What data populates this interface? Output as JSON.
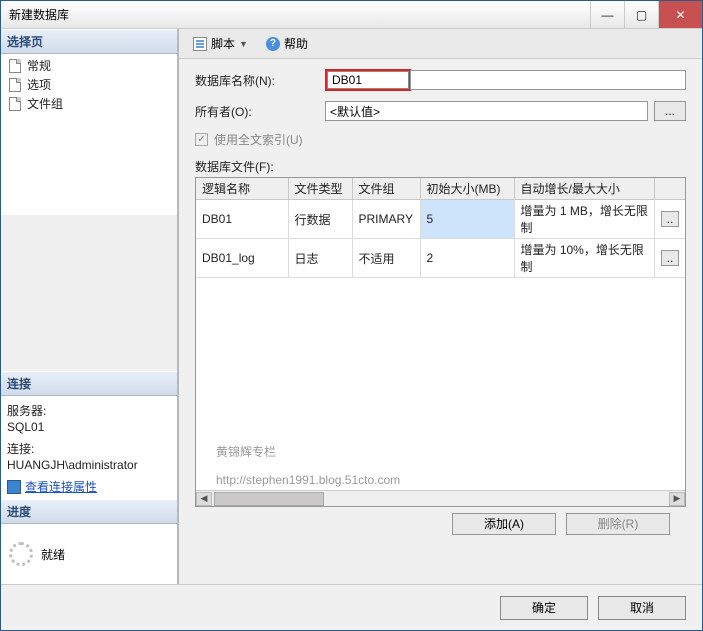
{
  "window_title": "新建数据库",
  "sidebar": {
    "select_page_title": "选择页",
    "pages": [
      {
        "label": "常规"
      },
      {
        "label": "选项"
      },
      {
        "label": "文件组"
      }
    ],
    "connection_title": "连接",
    "server_label": "服务器:",
    "server_value": "SQL01",
    "conn_label": "连接:",
    "conn_value": "HUANGJH\\administrator",
    "view_conn_link": "查看连接属性",
    "progress_title": "进度",
    "progress_status": "就绪"
  },
  "toolbar": {
    "script_label": "脚本",
    "help_label": "帮助"
  },
  "form": {
    "db_name_label": "数据库名称(N):",
    "db_name_value": "DB01",
    "owner_label": "所有者(O):",
    "owner_value": "<默认值>",
    "ellipsis": "...",
    "fulltext_label": "使用全文索引(U)",
    "files_label": "数据库文件(F):"
  },
  "table": {
    "headers": {
      "logical_name": "逻辑名称",
      "file_type": "文件类型",
      "filegroup": "文件组",
      "initial_size": "初始大小(MB)",
      "autogrowth": "自动增长/最大大小"
    },
    "rows": [
      {
        "logical_name": "DB01",
        "file_type": "行数据",
        "filegroup": "PRIMARY",
        "initial_size": "5",
        "autogrowth": "增量为 1 MB，增长无限制",
        "selected": true
      },
      {
        "logical_name": "DB01_log",
        "file_type": "日志",
        "filegroup": "不适用",
        "initial_size": "2",
        "autogrowth": "增量为 10%，增长无限制",
        "selected": false
      }
    ]
  },
  "buttons": {
    "add": "添加(A)",
    "remove": "删除(R)",
    "ok": "确定",
    "cancel": "取消"
  },
  "watermark": {
    "line1": "黄锦辉专栏",
    "line2": "http://stephen1991.blog.51cto.com"
  }
}
